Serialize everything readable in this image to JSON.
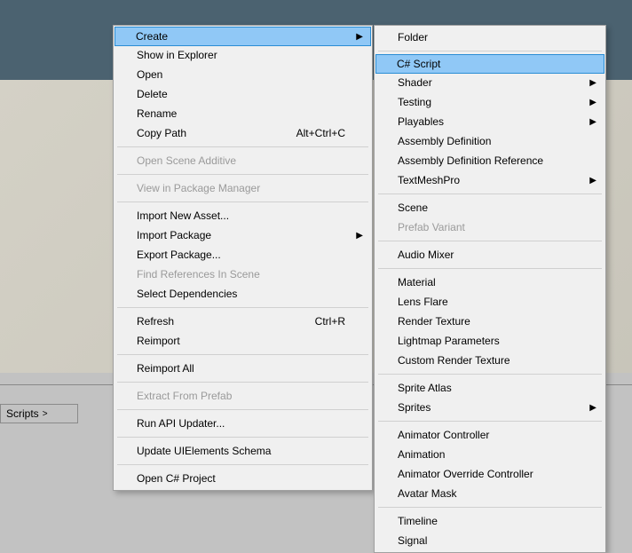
{
  "breadcrumb": {
    "label": "Scripts",
    "arrow": ">"
  },
  "main_menu": {
    "groups": [
      [
        {
          "name": "create",
          "label": "Create",
          "submenu": true,
          "highlighted": true
        },
        {
          "name": "show-in-explorer",
          "label": "Show in Explorer"
        },
        {
          "name": "open",
          "label": "Open"
        },
        {
          "name": "delete",
          "label": "Delete"
        },
        {
          "name": "rename",
          "label": "Rename"
        },
        {
          "name": "copy-path",
          "label": "Copy Path",
          "shortcut": "Alt+Ctrl+C"
        }
      ],
      [
        {
          "name": "open-scene-additive",
          "label": "Open Scene Additive",
          "disabled": true
        }
      ],
      [
        {
          "name": "view-in-package-manager",
          "label": "View in Package Manager",
          "disabled": true
        }
      ],
      [
        {
          "name": "import-new-asset",
          "label": "Import New Asset..."
        },
        {
          "name": "import-package",
          "label": "Import Package",
          "submenu": true
        },
        {
          "name": "export-package",
          "label": "Export Package..."
        },
        {
          "name": "find-references-in-scene",
          "label": "Find References In Scene",
          "disabled": true
        },
        {
          "name": "select-dependencies",
          "label": "Select Dependencies"
        }
      ],
      [
        {
          "name": "refresh",
          "label": "Refresh",
          "shortcut": "Ctrl+R"
        },
        {
          "name": "reimport",
          "label": "Reimport"
        }
      ],
      [
        {
          "name": "reimport-all",
          "label": "Reimport All"
        }
      ],
      [
        {
          "name": "extract-from-prefab",
          "label": "Extract From Prefab",
          "disabled": true
        }
      ],
      [
        {
          "name": "run-api-updater",
          "label": "Run API Updater..."
        }
      ],
      [
        {
          "name": "update-uielements-schema",
          "label": "Update UIElements Schema"
        }
      ],
      [
        {
          "name": "open-csharp-project",
          "label": "Open C# Project"
        }
      ]
    ]
  },
  "sub_menu": {
    "groups": [
      [
        {
          "name": "folder",
          "label": "Folder"
        }
      ],
      [
        {
          "name": "csharp-script",
          "label": "C# Script",
          "highlighted": true
        },
        {
          "name": "shader",
          "label": "Shader",
          "submenu": true
        },
        {
          "name": "testing",
          "label": "Testing",
          "submenu": true
        },
        {
          "name": "playables",
          "label": "Playables",
          "submenu": true
        },
        {
          "name": "assembly-definition",
          "label": "Assembly Definition"
        },
        {
          "name": "assembly-definition-reference",
          "label": "Assembly Definition Reference"
        },
        {
          "name": "textmeshpro",
          "label": "TextMeshPro",
          "submenu": true
        }
      ],
      [
        {
          "name": "scene",
          "label": "Scene"
        },
        {
          "name": "prefab-variant",
          "label": "Prefab Variant",
          "disabled": true
        }
      ],
      [
        {
          "name": "audio-mixer",
          "label": "Audio Mixer"
        }
      ],
      [
        {
          "name": "material",
          "label": "Material"
        },
        {
          "name": "lens-flare",
          "label": "Lens Flare"
        },
        {
          "name": "render-texture",
          "label": "Render Texture"
        },
        {
          "name": "lightmap-parameters",
          "label": "Lightmap Parameters"
        },
        {
          "name": "custom-render-texture",
          "label": "Custom Render Texture"
        }
      ],
      [
        {
          "name": "sprite-atlas",
          "label": "Sprite Atlas"
        },
        {
          "name": "sprites",
          "label": "Sprites",
          "submenu": true
        }
      ],
      [
        {
          "name": "animator-controller",
          "label": "Animator Controller"
        },
        {
          "name": "animation",
          "label": "Animation"
        },
        {
          "name": "animator-override-controller",
          "label": "Animator Override Controller"
        },
        {
          "name": "avatar-mask",
          "label": "Avatar Mask"
        }
      ],
      [
        {
          "name": "timeline",
          "label": "Timeline"
        },
        {
          "name": "signal",
          "label": "Signal"
        }
      ]
    ]
  }
}
